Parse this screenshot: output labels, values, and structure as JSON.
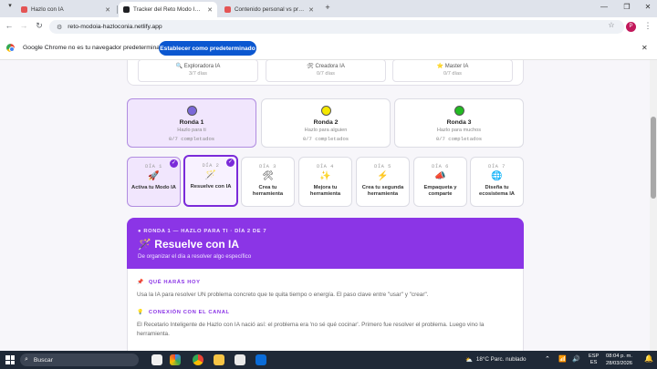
{
  "browser": {
    "tabs": [
      {
        "title": "Hazlo con IA",
        "active": false,
        "favicon_color": "#e45454"
      },
      {
        "title": "Tracker del Reto Modo IA — Ha...",
        "active": true,
        "favicon_color": "#202124"
      },
      {
        "title": "Contenido personal vs profesio...",
        "active": false,
        "favicon_color": "#e45454"
      }
    ],
    "new_tab_icon": "plus-icon",
    "url": "reto-modoia-hazloconia.netlify.app",
    "profile_initial": "P"
  },
  "infobar": {
    "text": "Google Chrome no es tu navegador predeterminado",
    "button_label": "Establecer como predeterminado"
  },
  "levels": [
    {
      "title": "Exploradora IA",
      "progress": "3/7 días",
      "icon": "🔍"
    },
    {
      "title": "Creadora IA",
      "progress": "0/7 días",
      "icon": "🛠"
    },
    {
      "title": "Master IA",
      "progress": "0/7 días",
      "icon": "⭐"
    }
  ],
  "rondas": [
    {
      "title": "Ronda 1",
      "subtitle": "Hazlo para ti",
      "completed": "0/7 completados",
      "dot_color": "#7b68d8",
      "selected": true
    },
    {
      "title": "Ronda 2",
      "subtitle": "Hazlo para alguien",
      "completed": "0/7 completados",
      "dot_color": "#f5e800",
      "selected": false
    },
    {
      "title": "Ronda 3",
      "subtitle": "Hazlo para muchos",
      "completed": "0/7 completados",
      "dot_color": "#22bb22",
      "selected": false
    }
  ],
  "days": [
    {
      "number": "DÍA 1",
      "label": "Activa tu Modo IA",
      "icon": "🚀",
      "state": "done"
    },
    {
      "number": "DÍA 2",
      "label": "Resuelve con IA",
      "icon": "🪄",
      "state": "current"
    },
    {
      "number": "DÍA 3",
      "label": "Crea tu herramienta",
      "icon": "🛠",
      "state": "todo"
    },
    {
      "number": "DÍA 4",
      "label": "Mejora tu herramienta",
      "icon": "✨",
      "state": "todo"
    },
    {
      "number": "DÍA 5",
      "label": "Crea tu segunda herramienta",
      "icon": "⚡",
      "state": "todo"
    },
    {
      "number": "DÍA 6",
      "label": "Empaqueta y comparte",
      "icon": "📣",
      "state": "todo"
    },
    {
      "number": "DÍA 7",
      "label": "Diseña tu ecosistema IA",
      "icon": "🌐",
      "state": "todo"
    }
  ],
  "detail": {
    "kicker": "RONDA 1 — HAZLO PARA TI · DÍA 2 DE 7",
    "title": "Resuelve con IA",
    "subtitle": "De organizar el día a resolver algo específico",
    "sections": [
      {
        "heading": "QUÉ HARÁS HOY",
        "icon": "📌",
        "text": "Usa la IA para resolver UN problema concreto que te quita tiempo o energía. El paso clave entre \"usar\" y \"crear\"."
      },
      {
        "heading": "CONEXIÓN CON EL CANAL",
        "icon": "💡",
        "text": "El Recetario Inteligente de Hazlo con IA nació así: el problema era 'no sé qué cocinar'. Primero fue resolver el problema. Luego vino la herramienta."
      }
    ]
  },
  "taskbar": {
    "search_label": "Buscar",
    "weather": "18°C  Parc. nublado",
    "lang_line1": "ESP",
    "lang_line2": "ES",
    "time": "08:04 p. m.",
    "date": "28/03/2026"
  },
  "colors": {
    "accent": "#8b35e6",
    "chrome_blue": "#0b57d0"
  }
}
